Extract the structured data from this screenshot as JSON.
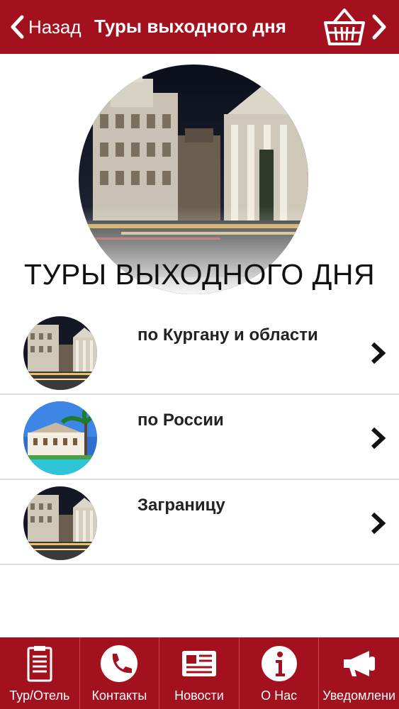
{
  "header": {
    "back_label": "Назад",
    "title": "Туры выходного дня",
    "cart_icon": "basket-icon",
    "forward_icon": "chevron-right-icon"
  },
  "hero": {
    "title": "ТУРЫ ВЫХОДНОГО ДНЯ"
  },
  "list": {
    "items": [
      {
        "label": "по Кургану и области",
        "image": "city-night-photo"
      },
      {
        "label": "по России",
        "image": "palm-building-photo"
      },
      {
        "label": "Заграницу",
        "image": "city-night-photo"
      }
    ]
  },
  "tabbar": {
    "tabs": [
      {
        "label": "Тур/Отель",
        "icon": "clipboard-icon"
      },
      {
        "label": "Контакты",
        "icon": "phone-icon"
      },
      {
        "label": "Новости",
        "icon": "newspaper-icon"
      },
      {
        "label": "О Нас",
        "icon": "info-icon"
      },
      {
        "label": "Уведомлени",
        "icon": "megaphone-icon"
      }
    ]
  },
  "colors": {
    "brand": "#a3111f",
    "text": "#222222",
    "divider": "#dcdcdc"
  }
}
